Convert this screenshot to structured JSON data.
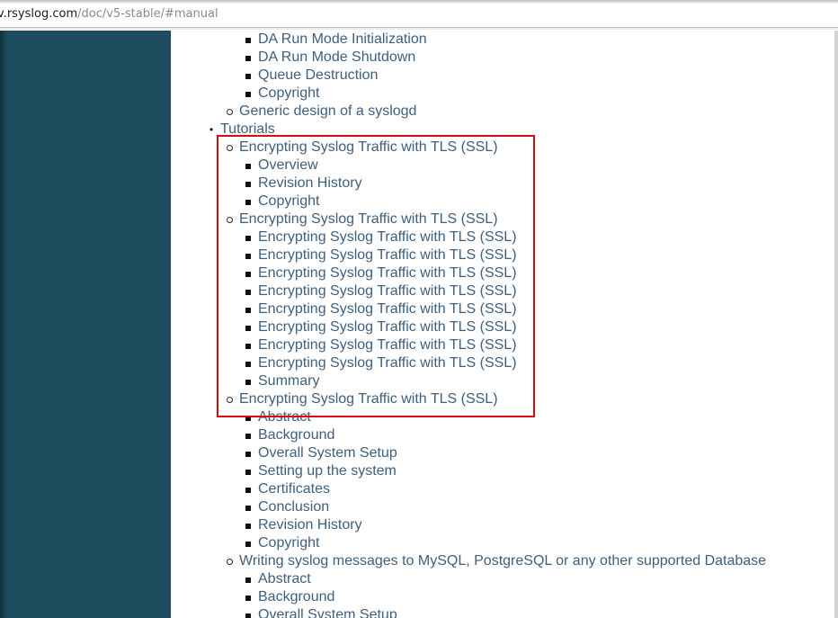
{
  "browser": {
    "url_host": "v.rsyslog.com",
    "url_path": "/doc/v5-stable/#manual"
  },
  "toc": [
    {
      "level": 3,
      "label": "DA Run Mode Initialization"
    },
    {
      "level": 3,
      "label": "DA Run Mode Shutdown"
    },
    {
      "level": 3,
      "label": "Queue Destruction"
    },
    {
      "level": 3,
      "label": "Copyright"
    },
    {
      "level": 2,
      "label": "Generic design of a syslogd"
    },
    {
      "level": 1,
      "label": "Tutorials"
    },
    {
      "level": 2,
      "label": "Encrypting Syslog Traffic with TLS (SSL)"
    },
    {
      "level": 3,
      "label": "Overview"
    },
    {
      "level": 3,
      "label": "Revision History"
    },
    {
      "level": 3,
      "label": "Copyright"
    },
    {
      "level": 2,
      "label": "Encrypting Syslog Traffic with TLS (SSL)"
    },
    {
      "level": 3,
      "label": "Encrypting Syslog Traffic with TLS (SSL)"
    },
    {
      "level": 3,
      "label": "Encrypting Syslog Traffic with TLS (SSL)"
    },
    {
      "level": 3,
      "label": "Encrypting Syslog Traffic with TLS (SSL)"
    },
    {
      "level": 3,
      "label": "Encrypting Syslog Traffic with TLS (SSL)"
    },
    {
      "level": 3,
      "label": "Encrypting Syslog Traffic with TLS (SSL)"
    },
    {
      "level": 3,
      "label": "Encrypting Syslog Traffic with TLS (SSL)"
    },
    {
      "level": 3,
      "label": "Encrypting Syslog Traffic with TLS (SSL)"
    },
    {
      "level": 3,
      "label": "Encrypting Syslog Traffic with TLS (SSL)"
    },
    {
      "level": 3,
      "label": "Summary"
    },
    {
      "level": 2,
      "label": "Encrypting Syslog Traffic with TLS (SSL)"
    },
    {
      "level": 3,
      "label": "Abstract"
    },
    {
      "level": 3,
      "label": "Background"
    },
    {
      "level": 3,
      "label": "Overall System Setup"
    },
    {
      "level": 3,
      "label": "Setting up the system"
    },
    {
      "level": 3,
      "label": "Certificates"
    },
    {
      "level": 3,
      "label": "Conclusion"
    },
    {
      "level": 3,
      "label": "Revision History"
    },
    {
      "level": 3,
      "label": "Copyright"
    },
    {
      "level": 2,
      "label": "Writing syslog messages to MySQL, PostgreSQL or any other supported Database"
    },
    {
      "level": 3,
      "label": "Abstract"
    },
    {
      "level": 3,
      "label": "Background"
    },
    {
      "level": 3,
      "label": "Overall System Setup"
    }
  ],
  "colors": {
    "sidebar": "#1c4c5e",
    "link": "#3e5f7e",
    "highlight": "#e0060f"
  }
}
